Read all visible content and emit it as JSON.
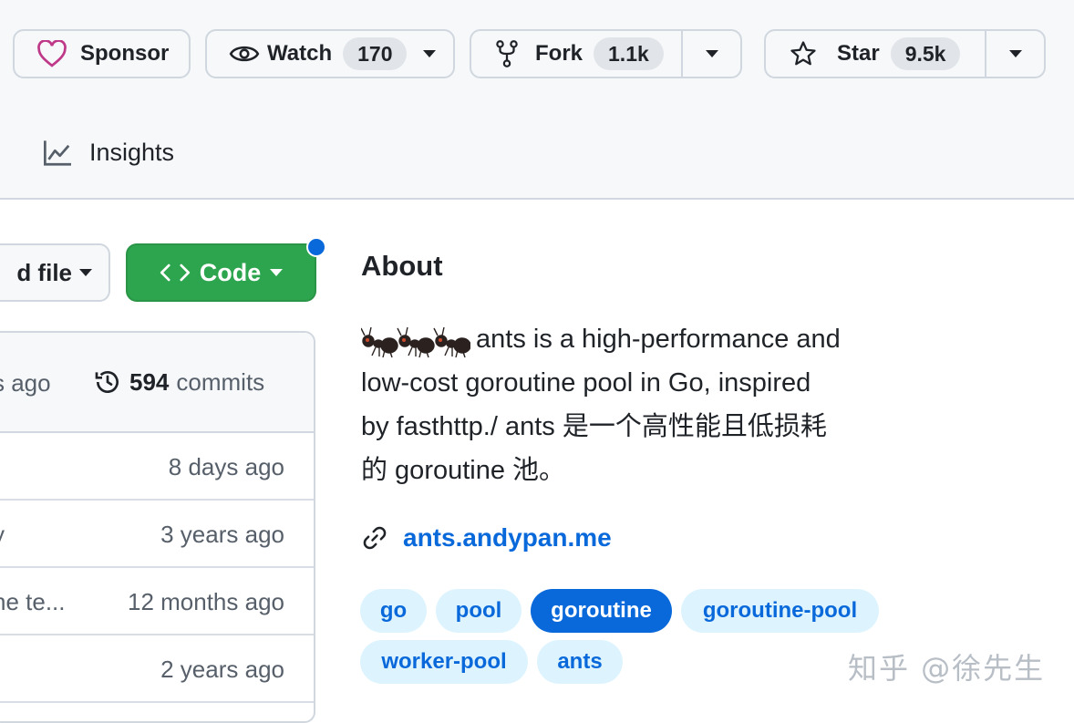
{
  "header": {
    "sponsor_label": "Sponsor",
    "watch_label": "Watch",
    "watch_count": "170",
    "fork_label": "Fork",
    "fork_count": "1.1k",
    "star_label": "Star",
    "star_count": "9.5k"
  },
  "nav": {
    "insights_label": "Insights"
  },
  "toolbar": {
    "add_file_label": "d file",
    "code_label": "Code"
  },
  "file_list": {
    "last_commit_ago": "s ago",
    "commit_count": "594",
    "commits_label": "commits",
    "rows": [
      {
        "message": "",
        "time": "8 days ago"
      },
      {
        "message": "y",
        "time": "3 years ago"
      },
      {
        "message": "ne te...",
        "time": "12 months ago"
      },
      {
        "message": "",
        "time": "2 years ago"
      }
    ]
  },
  "about": {
    "title": "About",
    "description_line1": "ants is a high-performance and",
    "description_line2": "low-cost goroutine pool in Go, inspired",
    "description_line3": "by fasthttp./ ants 是一个高性能且低损耗",
    "description_line4": "的 goroutine 池。",
    "website": "ants.andypan.me",
    "topics": [
      "go",
      "pool",
      "goroutine",
      "goroutine-pool",
      "worker-pool",
      "ants"
    ]
  },
  "watermark": "知乎 @徐先生",
  "colors": {
    "accent_blue": "#0969da",
    "code_green": "#2da44e",
    "sponsor_pink": "#bf3989",
    "border": "#d0d7de"
  }
}
